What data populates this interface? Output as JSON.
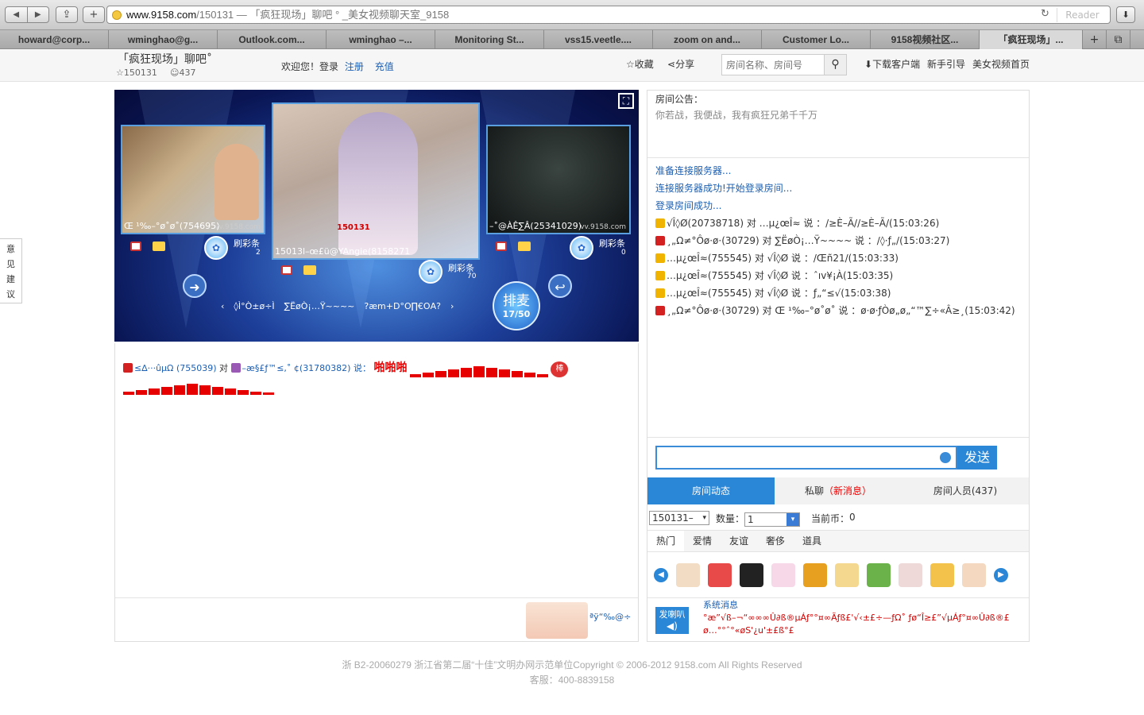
{
  "browser": {
    "url_domain": "www.9158.com",
    "url_path": "/150131",
    "page_title": " — 「疯狂现场」聊吧 ° _美女视频聊天室_9158",
    "reader": "Reader"
  },
  "tabs": [
    "howard@corp...",
    "wminghao@g...",
    "Outlook.com...",
    "wminghao –...",
    "Monitoring St...",
    "vss15.veetle....",
    "zoom on and...",
    "Customer Lo...",
    "9158视频社区...",
    "「疯狂现场」..."
  ],
  "room": {
    "title": "「疯狂现场」聊吧˚",
    "id": "150131",
    "members": "437"
  },
  "header": {
    "welcome": "欢迎您！登录",
    "register": "注册",
    "recharge": "充值",
    "favorite": "收藏",
    "share": "分享",
    "search_placeholder": "房间名称、房间号",
    "download": "下载客户端",
    "guide": "新手引导",
    "home": "美女视频首页"
  },
  "side_feedback": [
    "意",
    "见",
    "建",
    "议"
  ],
  "stage": {
    "left_label": "Œ ¹‰–°ø˚ø˚(754695)",
    "left_site": "vv.9158.com",
    "left_refresh": "刷彩条",
    "left_count": "2",
    "center_label": "15013l–œ£ü@YAngie(8158271",
    "center_tag": "150131",
    "center_refresh": "刷彩条",
    "center_count": "70",
    "right_label": "–˚@ÀÊ∑Â(25341029)",
    "right_site": "vv.9158.com",
    "right_refresh": "刷彩条",
    "right_count": "0",
    "queue_label": "排麦",
    "queue_count": "17/50",
    "users": [
      "◊Ì°Ò±ø÷Ì",
      "∑ËøÒ¡…Ÿ~~~~",
      "?æm+D°Ο∏€ΟΑ?"
    ]
  },
  "gift_message": {
    "sender": "≤∆···ûµΩ (755039)",
    "to": "对",
    "receiver": "–æ§£ƒ™≤,˚ ¢(31780382) 说：",
    "text": "啪啪啪"
  },
  "ad_text": "ªÿ“‰@÷",
  "notice": {
    "title": "房间公告：",
    "text": "你若战，我便战，我有疯狂兄弟千千万"
  },
  "messages": [
    {
      "kind": "sys",
      "text": "准备连接服务器..."
    },
    {
      "kind": "sys",
      "text": "连接服务器成功!开始登录房间..."
    },
    {
      "kind": "sys",
      "text": "登录房间成功..."
    },
    {
      "kind": "chat",
      "badge": "b1",
      "text": "√Î◊Ø(20738718) 对 …µ¿œÎ≈ 说 ：/≥È–Ã//≥È–Ã/(15:03:26)"
    },
    {
      "kind": "chat",
      "badge": "b2",
      "text": "¸„Ω≠°Ôø·ø·(30729) 对 ∑ËøÒ¡…Ÿ~~~~ 说 ：/◊·ƒ„/(15:03:27)"
    },
    {
      "kind": "chat",
      "badge": "b1",
      "text": "…µ¿œÎ≈(755545) 对 √Î◊Ø 说 ：/Œñ21/(15:03:33)"
    },
    {
      "kind": "chat",
      "badge": "b1",
      "text": "…µ¿œÎ≈(755545) 对 √Î◊Ø 说 ：ˆıv¥¡À(15:03:35)"
    },
    {
      "kind": "chat",
      "badge": "b1",
      "text": "…µ¿œÎ≈(755545) 对 √Î◊Ø 说 ：ƒ„“≤√(15:03:38)"
    },
    {
      "kind": "chat",
      "badge": "b2",
      "text": "¸„Ω≠°Ôø·ø·(30729) 对 Œ ¹‰–°ø˚ø˚ 说 ：ø·ø·ƒÒø„ø„“™∑÷«Â≥¸(15:03:42)"
    }
  ],
  "send_label": "发送",
  "panel_tabs": {
    "dynamic": "房间动态",
    "private": "私聊",
    "private_new": "（新消息）",
    "members": "房间人员(437)"
  },
  "gift_controls": {
    "target": "150131–",
    "qty_label": "数量：",
    "qty_value": "1",
    "coins_label": "当前币：",
    "coins_value": "0"
  },
  "gift_tabs": [
    "热门",
    "爱情",
    "友谊",
    "奢侈",
    "道具"
  ],
  "gift_icons": [
    "lollipop-icon",
    "watermelon-icon",
    "handbag-icon",
    "unicorn-icon",
    "gift-box-icon",
    "note-icon",
    "turtle-icon",
    "cow-icon",
    "clap-icon",
    "angel-icon"
  ],
  "horn": {
    "label": "发喇叭",
    "system": "系统消息",
    "text": "°æ”√ß–¬“∞∞∞Û∂ß®µÁƒ°°¤∞Ãƒß£'√‹±£÷—ƒΩ˚ ƒø“Î≥£”√µÁƒ°¤∞Û∂ß®£ ø…°°ˆ°«øS'¿u'±£ß°£"
  },
  "footer": {
    "line1": "浙 B2-20060279 浙江省第二届“十佳”文明办网示范单位Copyright © 2006-2012 9158.com All Rights Reserved",
    "line2": "客服：400-8839158"
  }
}
